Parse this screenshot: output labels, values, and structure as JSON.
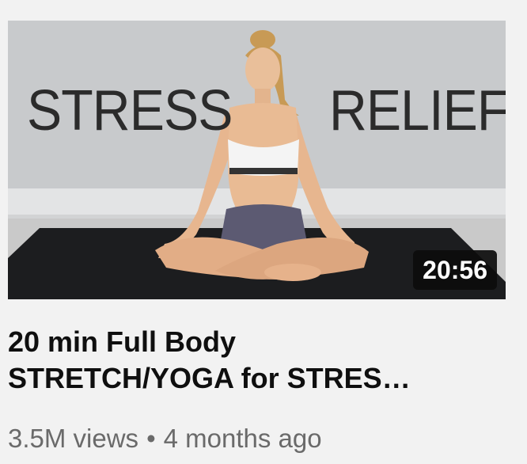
{
  "video": {
    "thumbnail_words": [
      "STRESS",
      "RELIEF"
    ],
    "duration": "20:56",
    "title_line1": "20 min Full Body",
    "title_line2": "STRETCH/YOGA for STRES…",
    "views": "3.5M views",
    "separator": "•",
    "uploaded": "4 months ago"
  },
  "colors": {
    "background": "#f2f2f2",
    "title_text": "#0f0f0f",
    "meta_text": "#6a6a6a",
    "duration_bg": "#0c0c0c",
    "mat": "#1c1d1f"
  },
  "icons": {
    "thumbnail_subject": "woman-meditating-illustration"
  }
}
